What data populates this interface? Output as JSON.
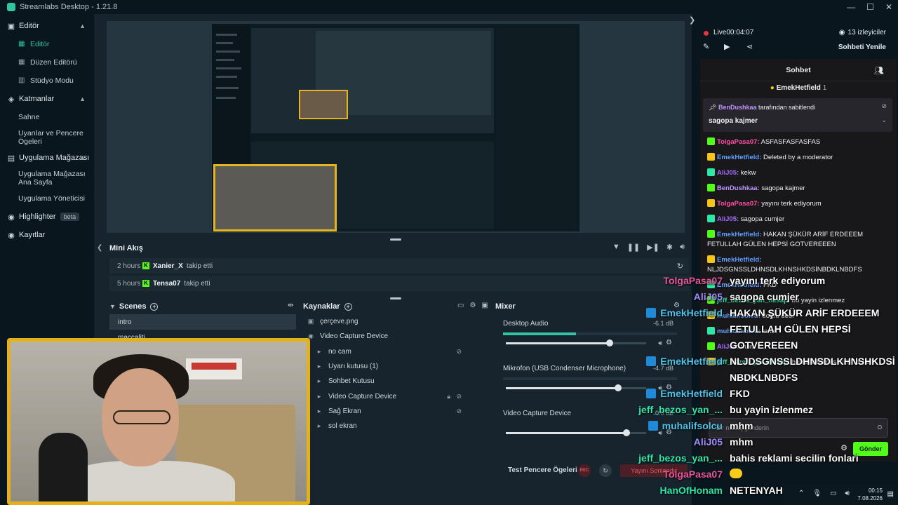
{
  "window": {
    "title": "Streamlabs Desktop - 1.21.8"
  },
  "sidebar": {
    "editor_section": "Editör",
    "editor_items": [
      "Editör",
      "Düzen Editörü",
      "Stüdyo Modu"
    ],
    "layers_section": "Katmanlar",
    "layers_items": [
      "Sahne",
      "Uyarılar ve Pencere Ögeleri"
    ],
    "store_section": "Uygulama Mağazası",
    "store_items": [
      "Uygulama Mağazası Ana Sayfa",
      "Uygulama Yöneticisi"
    ],
    "highlighter": "Highlighter",
    "beta": "beta",
    "recordings": "Kayıtlar"
  },
  "minifeed": {
    "title": "Mini Akış",
    "events": [
      {
        "time": "2 hours",
        "user": "Xanier_X",
        "action": "takip etti"
      },
      {
        "time": "5 hours",
        "user": "Tensa07",
        "action": "takip etti"
      }
    ]
  },
  "scenes": {
    "title": "Scenes",
    "items": [
      "intro",
      "maccaliti"
    ]
  },
  "sources": {
    "title": "Kaynaklar",
    "items": [
      {
        "name": "çerçeve.png",
        "icon": "image-icon"
      },
      {
        "name": "Video Capture Device",
        "icon": "camera-icon"
      },
      {
        "name": "no cam",
        "icon": "folder-icon"
      },
      {
        "name": "Uyarı kutusu (1)",
        "icon": "folder-icon"
      },
      {
        "name": "Sohbet Kutusu",
        "icon": "folder-icon"
      },
      {
        "name": "Video Capture Device",
        "icon": "folder-icon"
      },
      {
        "name": "Sağ Ekran",
        "icon": "folder-icon"
      },
      {
        "name": "sol ekran",
        "icon": "folder-icon"
      }
    ]
  },
  "mixer": {
    "title": "Mixer",
    "channels": [
      {
        "name": "Desktop Audio",
        "db": "-6.1 dB",
        "meter": 0.42,
        "level": 0.74
      },
      {
        "name": "Mikrofon (USB Condenser Microphone)",
        "db": "-4.7 dB",
        "meter": 0.0,
        "level": 0.8
      },
      {
        "name": "Video Capture Device",
        "db": "0.0 dB",
        "meter": 0.0,
        "level": 0.86
      }
    ]
  },
  "footer": {
    "test_widgets": "Test Pencere Ögeleri",
    "rec": "REC",
    "end_stream": "Yayını Sonlandır"
  },
  "chat_panel": {
    "live": "Live",
    "timer": "00:04:07",
    "viewers": "13 izleyiciler",
    "refresh": "Sohbeti Yenile",
    "chat_title": "Sohbet",
    "top_gifter": "EmekHetfield",
    "top_gifter_count": "1",
    "pinned_user": "BenDushkaa",
    "pinned_label": "tarafından sabitlendi",
    "pinned_message": "sagopa kajmer",
    "messages": [
      {
        "user": "TolgaPasa07:",
        "text": "ASFASFASFASFAS",
        "color": "#ff4fa3"
      },
      {
        "user": "EmekHetfield:",
        "text": "Deleted by a moderator",
        "color": "#5f9fff"
      },
      {
        "user": "AliJ05:",
        "text": "kekw",
        "color": "#a56bff"
      },
      {
        "user": "BenDushkaa:",
        "text": "sagopa kajmer",
        "color": "#bf94ff"
      },
      {
        "user": "TolgaPasa07:",
        "text": "yayını terk ediyorum",
        "color": "#ff4fa3"
      },
      {
        "user": "AliJ05:",
        "text": "sagopa cumjer",
        "color": "#a56bff"
      },
      {
        "user": "EmekHetfield:",
        "text": "HAKAN ŞÜKÜR ARİF ERDEEEM FETULLAH GÜLEN HEPSİ GOTVEREEEN",
        "color": "#5f9fff"
      },
      {
        "user": "EmekHetfield:",
        "text": "NLJDSGNSSLDHNSDLKHNSHKDSİNBDKLNBDFS",
        "color": "#5f9fff"
      },
      {
        "user": "EmekHetfield:",
        "text": "FKD",
        "color": "#5f9fff"
      },
      {
        "user": "jeff_bezos_yan_hesap:",
        "text": "bu yayin izlenmez",
        "color": "#2ee6a6"
      },
      {
        "user": "muhalifsolcu:",
        "text": "doğru dedi",
        "color": "#5f9fff"
      },
      {
        "user": "muhalifsolcu:",
        "text": "mhm",
        "color": "#5f9fff"
      },
      {
        "user": "AliJ05:",
        "text": "mhm",
        "color": "#a56bff"
      },
      {
        "user": "jeff_bezos_yan_hesap:",
        "text": "bahis reklami secilin fonlari",
        "color": "#2ee6a6"
      }
    ],
    "input_placeholder": "Bir mesaj gönderin",
    "send": "Gönder"
  },
  "overlay": [
    {
      "user": "TolgaPasa07",
      "msg": "yayını terk ediyorum",
      "color": "#e5559a",
      "badge": ""
    },
    {
      "user": "AliJ05",
      "msg": "sagopa cumjer",
      "color": "#9f8cff",
      "badge": ""
    },
    {
      "user": "EmekHetfield",
      "msg": "HAKAN ŞÜKÜR ARİF ERDEEEM",
      "color": "#4fc2e8",
      "badge": "#1f8ad9"
    },
    {
      "user": "",
      "msg": "FETULLAH GÜLEN HEPSİ",
      "color": "#4fc2e8",
      "badge": ""
    },
    {
      "user": "",
      "msg": "GOTVEREEEN",
      "color": "#4fc2e8",
      "badge": ""
    },
    {
      "user": "EmekHetfield",
      "msg": "NLJDSGNSSLDHNSDLKHNSHKDSİ",
      "color": "#4fc2e8",
      "badge": "#1f8ad9"
    },
    {
      "user": "",
      "msg": "NBDKLNBDFS",
      "color": "#4fc2e8",
      "badge": ""
    },
    {
      "user": "EmekHetfield",
      "msg": "FKD",
      "color": "#4fc2e8",
      "badge": "#1f8ad9"
    },
    {
      "user": "jeff_bezos_yan_...",
      "msg": "bu yayin izlenmez",
      "color": "#2ee6a6",
      "badge": ""
    },
    {
      "user": "muhalifsolcu",
      "msg": "mhm",
      "color": "#4fc2e8",
      "badge": "#1f8ad9"
    },
    {
      "user": "AliJ05",
      "msg": "mhm",
      "color": "#9f8cff",
      "badge": ""
    },
    {
      "user": "jeff_bezos_yan_...",
      "msg": "bahis reklami secilin fonlari",
      "color": "#2ee6a6",
      "badge": ""
    },
    {
      "user": "TolgaPasa07",
      "msg": "",
      "color": "#e5559a",
      "badge": ""
    },
    {
      "user": "HanOfHonam",
      "msg": "NETENYAHU",
      "color": "#2ee6a6",
      "badge": ""
    }
  ],
  "taskbar": {
    "time": "00:15",
    "date": "7.08.2026"
  }
}
